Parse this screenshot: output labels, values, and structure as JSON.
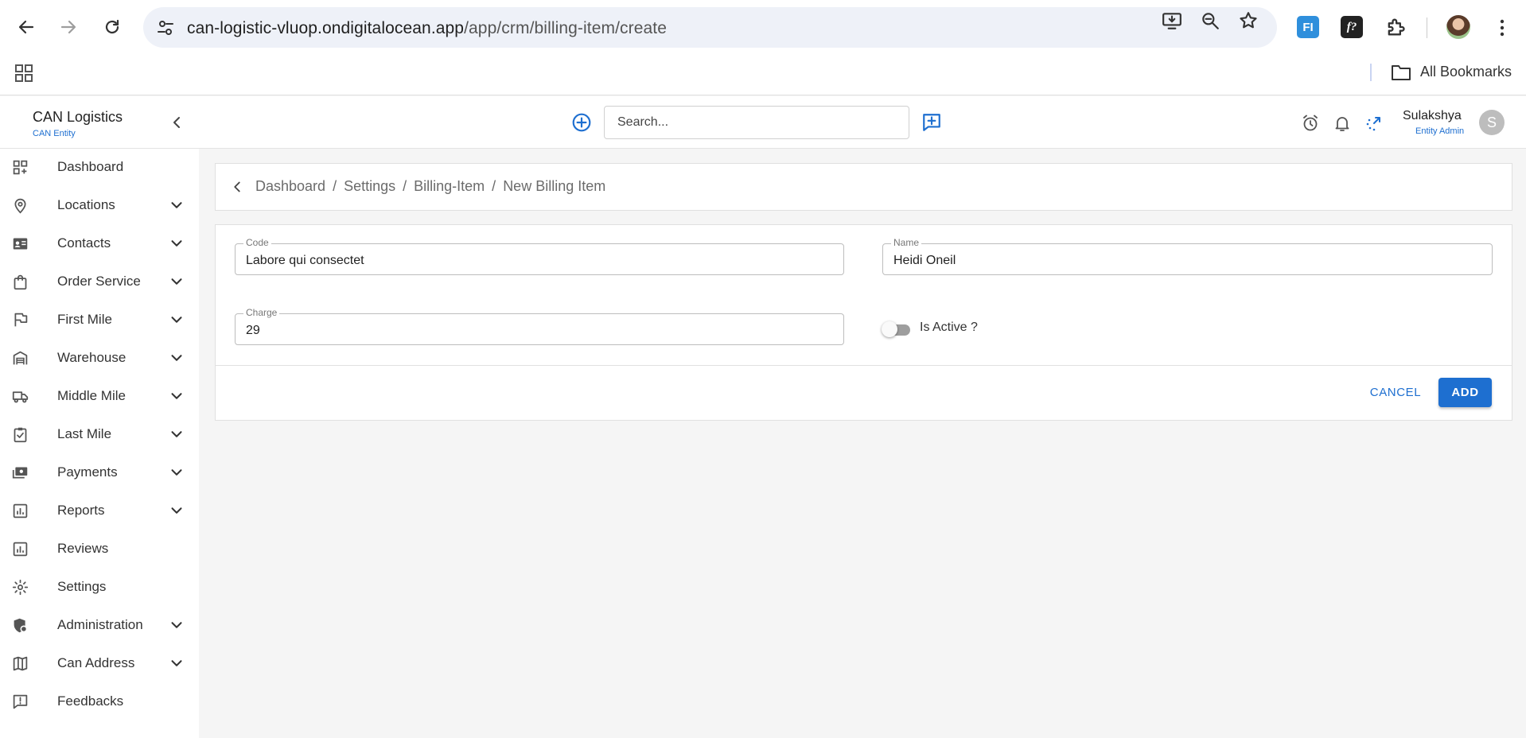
{
  "browser": {
    "url_host": "can-logistic-vluop.ondigitalocean.app",
    "url_path": "/app/crm/billing-item/create",
    "extension_fi_label": "FI",
    "extension_f_label": "f?",
    "bookmarks_label": "All Bookmarks"
  },
  "brand": {
    "name": "CAN Logistics",
    "sub": "CAN Entity"
  },
  "search": {
    "placeholder": "Search..."
  },
  "user": {
    "name": "Sulakshya",
    "role": "Entity Admin",
    "initial": "S"
  },
  "sidebar": {
    "items": [
      {
        "label": "Dashboard",
        "icon": "dashboard-icon",
        "expandable": false
      },
      {
        "label": "Locations",
        "icon": "location-pin-icon",
        "expandable": true
      },
      {
        "label": "Contacts",
        "icon": "contact-card-icon",
        "expandable": true
      },
      {
        "label": "Order Service",
        "icon": "shopping-bag-icon",
        "expandable": true
      },
      {
        "label": "First Mile",
        "icon": "flag-icon",
        "expandable": true
      },
      {
        "label": "Warehouse",
        "icon": "warehouse-icon",
        "expandable": true
      },
      {
        "label": "Middle Mile",
        "icon": "truck-icon",
        "expandable": true
      },
      {
        "label": "Last Mile",
        "icon": "clipboard-check-icon",
        "expandable": true
      },
      {
        "label": "Payments",
        "icon": "payments-icon",
        "expandable": true
      },
      {
        "label": "Reports",
        "icon": "bar-chart-icon",
        "expandable": true
      },
      {
        "label": "Reviews",
        "icon": "reviews-chart-icon",
        "expandable": false
      },
      {
        "label": "Settings",
        "icon": "gear-icon",
        "expandable": false
      },
      {
        "label": "Administration",
        "icon": "admin-shield-icon",
        "expandable": true
      },
      {
        "label": "Can Address",
        "icon": "map-icon",
        "expandable": true
      },
      {
        "label": "Feedbacks",
        "icon": "feedback-icon",
        "expandable": false
      }
    ]
  },
  "breadcrumb": {
    "items": [
      "Dashboard",
      "Settings",
      "Billing-Item",
      "New Billing Item"
    ],
    "separator": "/"
  },
  "form": {
    "code": {
      "label": "Code",
      "value": "Labore qui consectet"
    },
    "name": {
      "label": "Name",
      "value": "Heidi Oneil"
    },
    "charge": {
      "label": "Charge",
      "value": "29"
    },
    "is_active": {
      "label": "Is Active ?",
      "checked": false
    },
    "cancel_label": "CANCEL",
    "add_label": "ADD"
  },
  "colors": {
    "accent": "#1e6fd0",
    "background": "#f5f5f5"
  }
}
